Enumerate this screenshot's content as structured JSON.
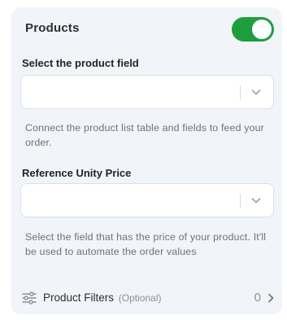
{
  "products": {
    "title": "Products",
    "toggle_on": true,
    "toggle_color": "#1e9e3f"
  },
  "product_field": {
    "label": "Select the product field",
    "value": "",
    "help": "Connect the product list table and fields to feed your order."
  },
  "unity_price": {
    "label": "Reference Unity Price",
    "value": "",
    "help": "Select the field that has the price of your product. It'll be used to automate the order values"
  },
  "filters": {
    "label": "Product Filters",
    "optional": "(Optional)",
    "count": "0",
    "icon": "sliders-icon"
  }
}
